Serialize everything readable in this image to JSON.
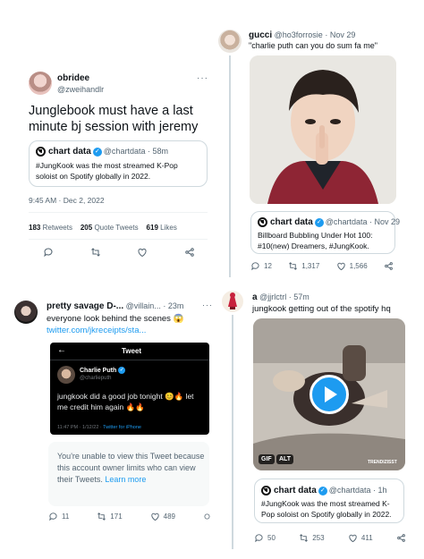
{
  "t1": {
    "name": "obridee",
    "handle": "@zweihandlr",
    "text": "Junglebook must have a last minute bj session with jeremy",
    "quote": {
      "name": "chart data",
      "handle": "@chartdata",
      "sep": "·",
      "time": "58m",
      "text": "#JungKook was the most streamed K-Pop soloist on Spotify globally in 2022."
    },
    "timestamp": "9:45 AM · Dec 2, 2022",
    "retweets": "183",
    "retweets_label": "Retweets",
    "quotes": "205",
    "quotes_label": "Quote Tweets",
    "likes": "619",
    "likes_label": "Likes"
  },
  "t2": {
    "name": "gucci",
    "handle": "@ho3forrosie",
    "sep": "·",
    "time": "Nov 29",
    "text": "\"charlie puth can you do sum fa me\"",
    "quote": {
      "name": "chart data",
      "handle": "@chartdata",
      "sep": "·",
      "time": "Nov 29",
      "text": "Billboard Bubbling Under Hot 100: #10(new) Dreamers, #JungKook."
    },
    "replies": "12",
    "retweets": "1,317",
    "likes": "1,566"
  },
  "t3": {
    "name": "pretty savage D-...",
    "handle": "@villain...",
    "sep": "·",
    "time": "23m",
    "text": "everyone look behind the scenes 😱",
    "link": "twitter.com/jkreceipts/sta...",
    "embed": {
      "header": "Tweet",
      "name": "Charlie Puth",
      "handle": "@charlieputh",
      "text": "jungkook did a good job tonight 😊🔥 let me credit him again 🔥🔥",
      "footer_time": "11:47 PM · 1/12/22 ·",
      "footer_app": "Twitter for iPhone"
    },
    "unavailable": "You're unable to view this Tweet because this account owner limits who can view their Tweets.",
    "learn_more": "Learn more",
    "replies": "11",
    "retweets": "171",
    "likes": "489"
  },
  "t4": {
    "name": "a",
    "handle": "@jjrlctrl",
    "sep": "·",
    "time": "57m",
    "text": "jungkook getting out of the spotify hq",
    "gif_badge": "GIF",
    "alt_badge": "ALT",
    "watermark": "TRENDIZISST",
    "quote": {
      "name": "chart data",
      "handle": "@chartdata",
      "sep": "·",
      "time": "1h",
      "text": "#JungKook was the most streamed K-Pop soloist on Spotify globally in 2022."
    },
    "replies": "50",
    "retweets": "253",
    "likes": "411"
  },
  "more": "···",
  "colors": {
    "blue": "#1d9bf0",
    "text": "#0f1419",
    "muted": "#536471",
    "border": "#cfd9de"
  }
}
